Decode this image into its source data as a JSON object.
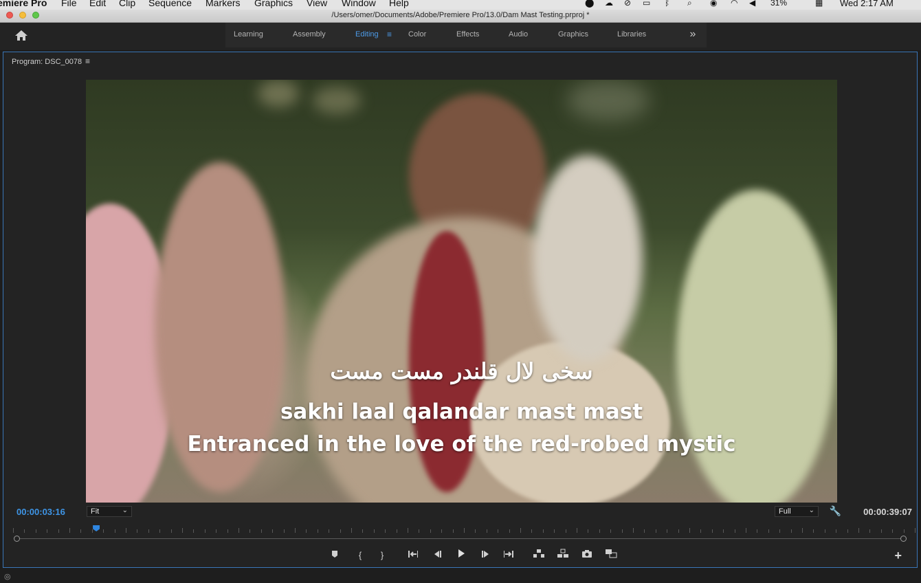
{
  "menubar": {
    "app": "emiere Pro",
    "items": [
      "File",
      "Edit",
      "Clip",
      "Sequence",
      "Markers",
      "Graphics",
      "View",
      "Window",
      "Help"
    ],
    "battery": "31%",
    "clock": "Wed 2:17 AM"
  },
  "window": {
    "title": "/Users/omer/Documents/Adobe/Premiere Pro/13.0/Dam Mast Testing.prproj *"
  },
  "workspaces": {
    "tabs": [
      "Learning",
      "Assembly",
      "Editing",
      "Color",
      "Effects",
      "Audio",
      "Graphics",
      "Libraries"
    ],
    "active": "Editing",
    "more": "»"
  },
  "program": {
    "title": "Program: DSC_0078",
    "menu_icon": "≡",
    "subtitles": {
      "urdu": "سخی لال قلندر مست مست",
      "roman": "sakhi laal qalandar mast mast",
      "english": "Entranced in the love of the red-robed mystic"
    },
    "timecode_current": "00:00:03:16",
    "timecode_duration": "00:00:39:07",
    "zoom": "Fit",
    "resolution": "Full",
    "playhead_fraction": 0.09
  },
  "transport": {
    "buttons": [
      "marker",
      "mark-in",
      "mark-out",
      "go-to-in",
      "step-back",
      "play",
      "step-forward",
      "go-to-out",
      "lift",
      "extract",
      "export-frame",
      "comparison-view"
    ],
    "plus": "+"
  },
  "colors": {
    "accent": "#4d9be8",
    "timecode_blue": "#3e95e6",
    "panel_border": "#3a76b8"
  }
}
